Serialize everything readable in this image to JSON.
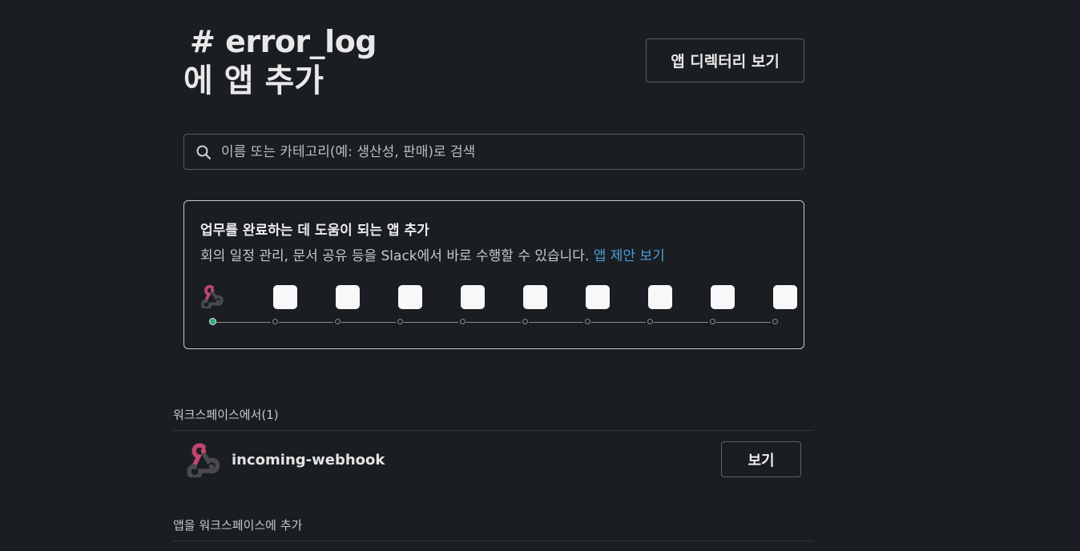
{
  "header": {
    "title_line1": "# error_log",
    "title_line2": "에 앱 추가",
    "directory_button": "앱 디렉터리 보기"
  },
  "search": {
    "placeholder": "이름 또는 카테고리(예: 생산성, 판매)로 검색",
    "value": ""
  },
  "promo": {
    "title": "업무를 완료하는 데 도움이 되는 앱 추가",
    "description": "회의 일정 관리, 문서 공유 등을 Slack에서 바로 수행할 수 있습니다. ",
    "link": "앱 제안 보기",
    "carousel_total": 10,
    "carousel_active_index": 0
  },
  "workspace_section": {
    "label": "워크스페이스에서(1)",
    "apps": [
      {
        "name": "incoming-webhook",
        "button": "보기"
      }
    ]
  },
  "add_section": {
    "label": "앱을 워크스페이스에 추가"
  },
  "colors": {
    "background": "#1a1d21",
    "link": "#4a9fd9",
    "webhook_pink": "#c1466e",
    "webhook_dark": "#4a4a4e",
    "active_dot": "#2bac76"
  }
}
